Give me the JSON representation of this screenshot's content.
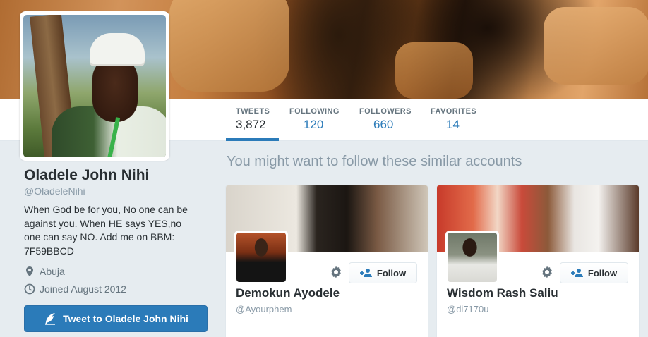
{
  "profile": {
    "name": "Oladele John Nihi",
    "handle": "@OladeleNihi",
    "bio": "When God be for you, No one can be against you. When HE says YES,no one can say NO. Add me on BBM: 7F59BBCD",
    "location": "Abuja",
    "joined": "Joined August 2012",
    "tweet_to_label": "Tweet to Oladele John Nihi"
  },
  "stats": [
    {
      "label": "TWEETS",
      "value": "3,872"
    },
    {
      "label": "FOLLOWING",
      "value": "120"
    },
    {
      "label": "FOLLOWERS",
      "value": "660"
    },
    {
      "label": "FAVORITES",
      "value": "14"
    }
  ],
  "suggestions": {
    "title": "You might want to follow these similar accounts",
    "accounts": [
      {
        "name": "Demokun Ayodele",
        "handle": "@Ayourphem",
        "follow_label": "Follow"
      },
      {
        "name": "Wisdom Rash Saliu",
        "handle": "@di7170u",
        "follow_label": "Follow"
      }
    ]
  },
  "colors": {
    "accent": "#2b7bb9",
    "muted": "#8899a6",
    "text": "#292f33",
    "background": "#e6ecf0"
  },
  "icons": {
    "location": "map-pin-icon",
    "joined": "clock-icon",
    "tweet_to": "quill-icon",
    "settings": "gear-icon",
    "follow": "add-user-icon"
  }
}
